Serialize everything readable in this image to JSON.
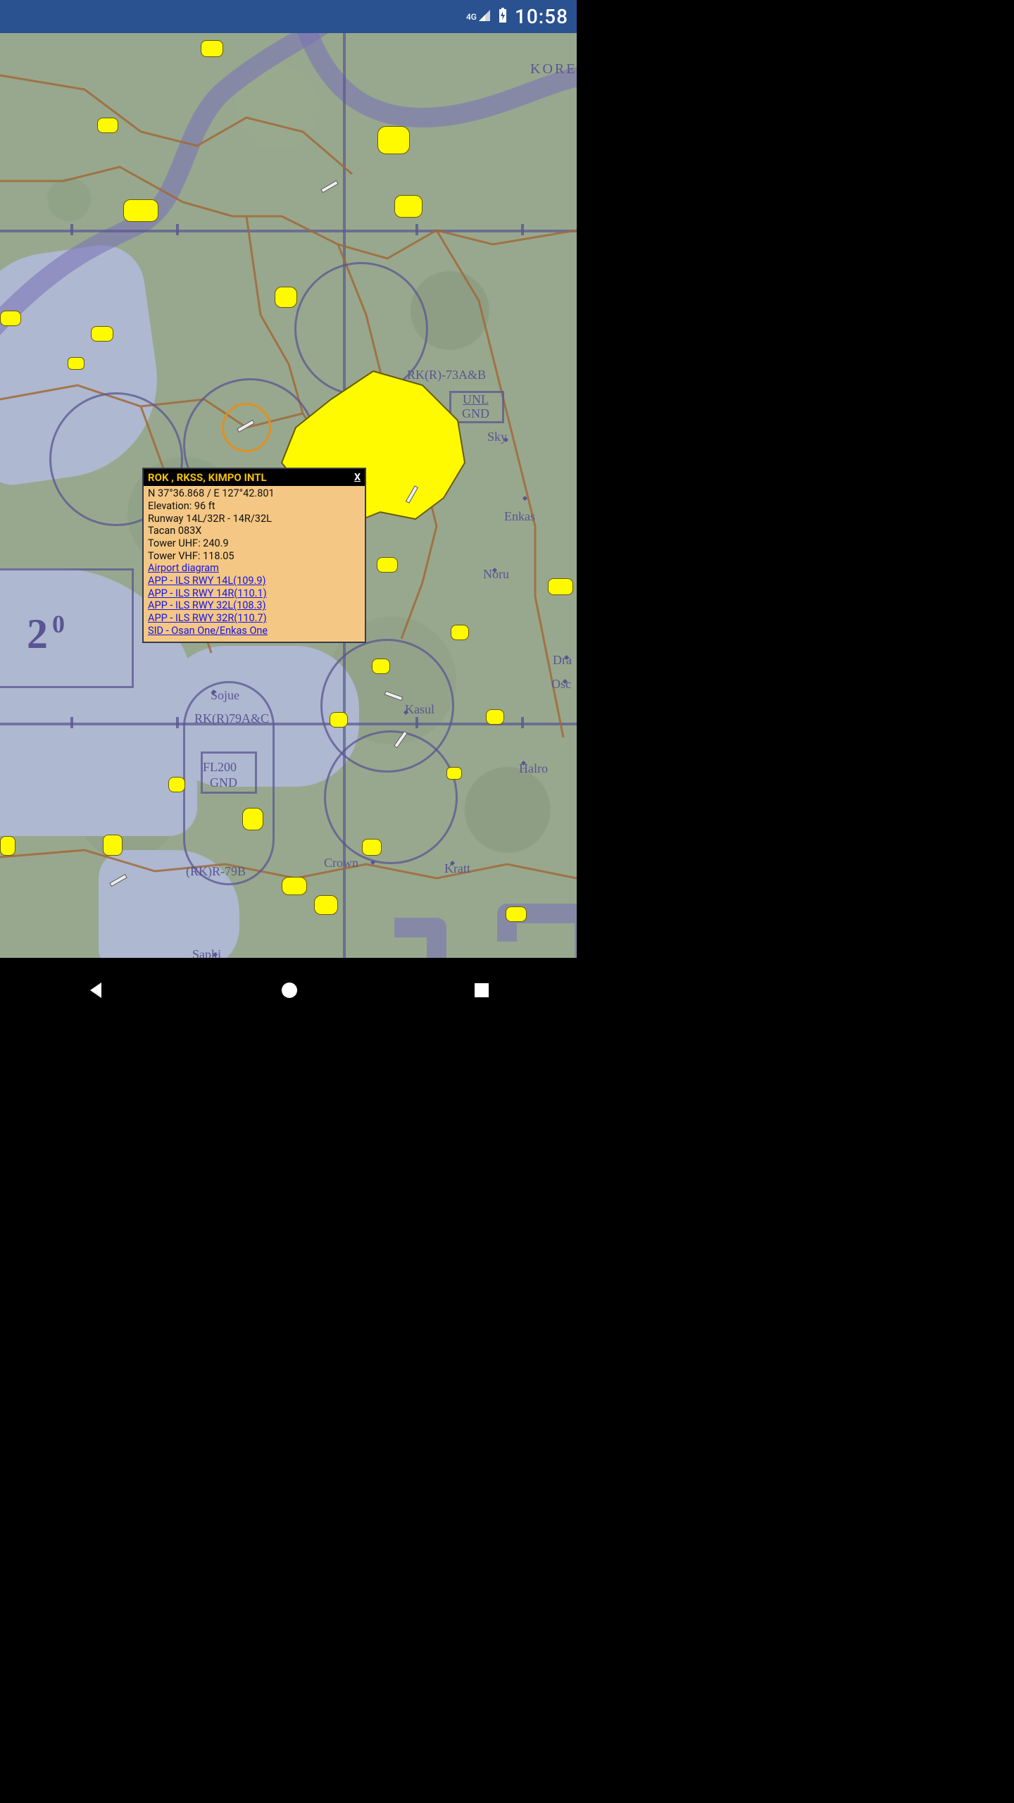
{
  "status": {
    "network": "4G",
    "clock": "10:58"
  },
  "map": {
    "labels": {
      "kore": "KORE",
      "zone73": "RK(R)-73A&B",
      "unl": "UNL",
      "gnd": "GND",
      "sky": "Sky",
      "enkas": "Enkas",
      "noru": "Noru",
      "dra": "Dra",
      "osc": "Osc",
      "halro": "Halro",
      "kratt": "Kratt",
      "crown": "Crown",
      "sapki": "Sapki",
      "sojue": "Sojue",
      "zone79ac": "RK(R)79A&C",
      "fl200": "FL200",
      "gnd2": "GND",
      "zone79b": "(RK)R-79B",
      "kasul": "Kasul",
      "two_deg": "2",
      "two_deg_sup": "0"
    }
  },
  "popup": {
    "title": "ROK , RKSS, KIMPO INTL",
    "close": "X",
    "coords": "N 37°36.868 / E 127°42.801",
    "elevation": "Elevation: 96 ft",
    "runway": "Runway 14L/32R - 14R/32L",
    "tacan": "Tacan 083X",
    "tower_uhf": "Tower UHF: 240.9",
    "tower_vhf": "Tower VHF: 118.05",
    "links": {
      "diagram": "Airport diagram",
      "app14l": "APP - ILS RWY 14L(109.9)",
      "app14r": "APP - ILS RWY 14R(110.1)",
      "app32l": "APP - ILS RWY 32L(108.3)",
      "app32r": "APP - ILS RWY 32R(110.7)",
      "sid": "SID - Osan One/Enkas One"
    }
  }
}
